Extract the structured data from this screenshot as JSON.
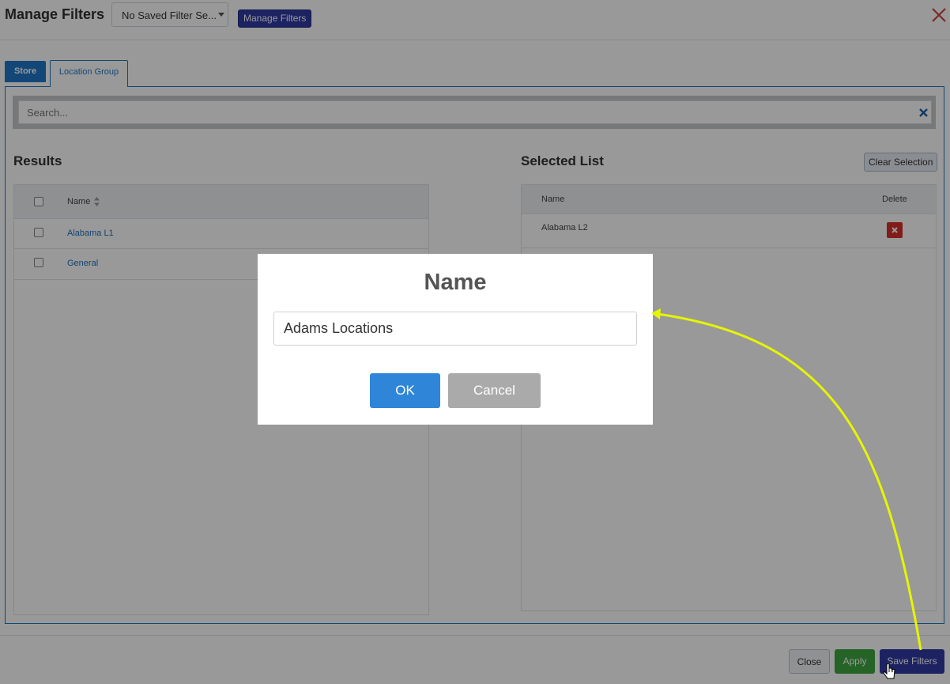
{
  "header": {
    "title": "Manage Filters",
    "saved_filter_select": "No Saved Filter Se...",
    "manage_filters_button": "Manage Filters"
  },
  "tabs": [
    {
      "label": "Store",
      "active": false
    },
    {
      "label": "Location Group",
      "active": true
    }
  ],
  "search": {
    "placeholder": "Search..."
  },
  "results": {
    "title": "Results",
    "column_name": "Name",
    "rows": [
      "Alabama L1",
      "General"
    ]
  },
  "selected": {
    "title": "Selected List",
    "clear_button": "Clear Selection",
    "column_name": "Name",
    "column_delete": "Delete",
    "rows": [
      "Alabama L2"
    ]
  },
  "footer": {
    "close": "Close",
    "apply": "Apply",
    "save": "Save Filters"
  },
  "modal": {
    "title": "Name",
    "input_value": "Adams Locations",
    "ok": "OK",
    "cancel": "Cancel"
  },
  "colors": {
    "primary_blue": "#1f77c9",
    "save_navy": "#2f3aa3",
    "apply_green": "#3fa640",
    "delete_red": "#d9302a",
    "annotation_arrow": "#e6f500"
  }
}
